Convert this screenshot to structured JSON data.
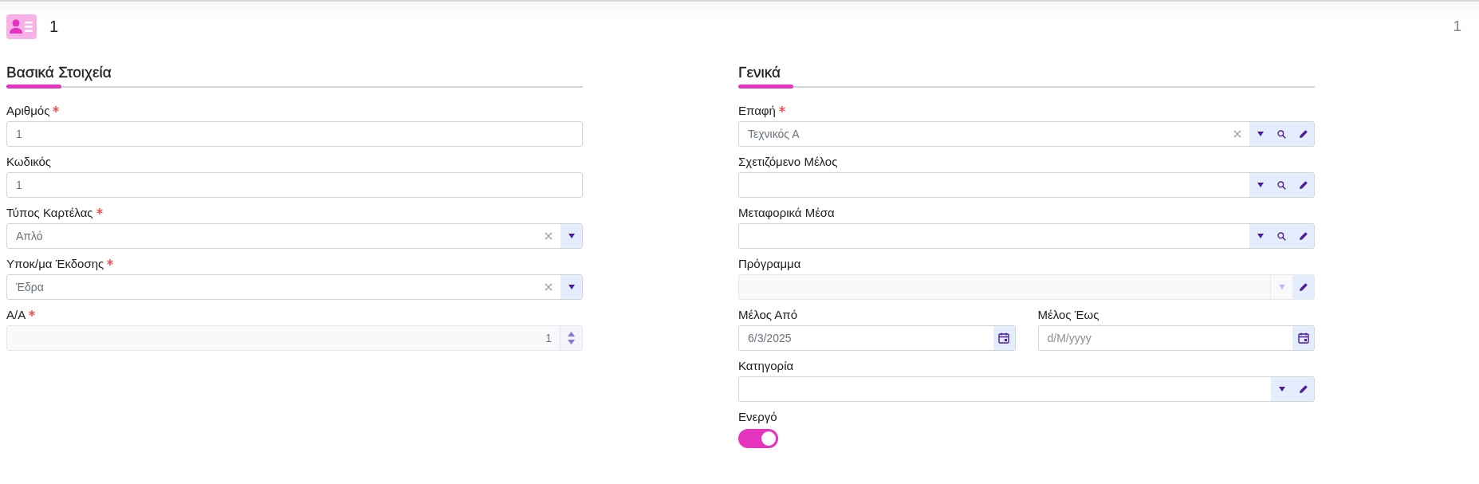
{
  "header": {
    "title": "1",
    "counter": "1"
  },
  "sections": [
    {
      "title": "Βασικά Στοιχεία",
      "rows": [
        {
          "fields": [
            {
              "kind": "text",
              "label": "Αριθμός",
              "required": true,
              "value": "1"
            }
          ]
        },
        {
          "fields": [
            {
              "kind": "text",
              "label": "Κωδικός",
              "required": false,
              "value": "1"
            }
          ]
        },
        {
          "fields": [
            {
              "kind": "select",
              "label": "Τύπος Καρτέλας",
              "required": true,
              "value": "Απλό",
              "clearable": true
            }
          ]
        },
        {
          "fields": [
            {
              "kind": "select",
              "label": "Υποκ/μα Έκδοσης",
              "required": true,
              "value": "Έδρα",
              "clearable": true
            }
          ]
        },
        {
          "fields": [
            {
              "kind": "number",
              "label": "Α/Α",
              "required": true,
              "value": "1",
              "disabled": true
            }
          ]
        }
      ]
    },
    {
      "title": "Γενικά",
      "rows": [
        {
          "fields": [
            {
              "kind": "lookup",
              "label": "Επαφή",
              "required": true,
              "value": "Τεχνικός Α",
              "clearable": true,
              "searchable": true
            }
          ]
        },
        {
          "fields": [
            {
              "kind": "lookup",
              "label": "Σχετιζόμενο Μέλος",
              "required": false,
              "searchable": true
            }
          ]
        },
        {
          "fields": [
            {
              "kind": "lookup",
              "label": "Μεταφορικά Μέσα",
              "required": false,
              "searchable": true
            }
          ]
        },
        {
          "fields": [
            {
              "kind": "lookup",
              "label": "Πρόγραμμα",
              "required": false,
              "searchable": false,
              "disabled": true
            }
          ]
        },
        {
          "fields": [
            {
              "kind": "date",
              "label": "Μέλος Από",
              "required": false,
              "value": "6/3/2025"
            },
            {
              "kind": "date",
              "label": "Μέλος Έως",
              "required": false,
              "placeholder": "d/M/yyyy"
            }
          ]
        },
        {
          "fields": [
            {
              "kind": "lookup",
              "label": "Κατηγορία",
              "required": false,
              "searchable": false
            }
          ]
        },
        {
          "fields": [
            {
              "kind": "toggle",
              "label": "Ενεργό",
              "on": true
            }
          ]
        }
      ]
    }
  ]
}
